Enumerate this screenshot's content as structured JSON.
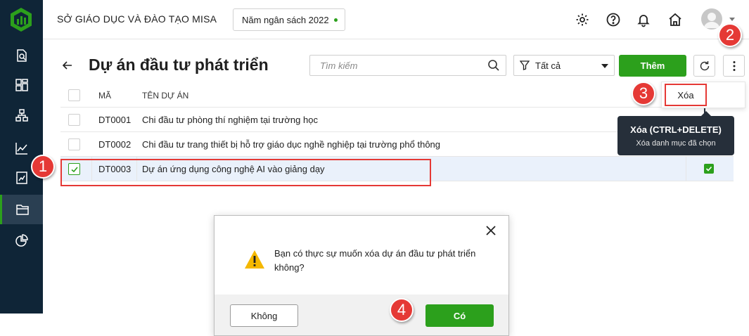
{
  "header": {
    "org_name": "SỞ GIÁO DỤC VÀ ĐÀO TẠO MISA",
    "budget_year": "Năm ngân sách 2022"
  },
  "sidebar": {
    "items": [
      {
        "icon": "search-document-icon"
      },
      {
        "icon": "dashboard-icon"
      },
      {
        "icon": "org-chart-icon"
      },
      {
        "icon": "line-chart-icon"
      },
      {
        "icon": "report-icon"
      },
      {
        "icon": "folder-icon",
        "active": true
      },
      {
        "icon": "pie-chart-icon"
      }
    ]
  },
  "page": {
    "title": "Dự án đầu tư phát triển",
    "search_placeholder": "Tìm kiếm",
    "filter_value": "Tất cả",
    "add_label": "Thêm"
  },
  "table": {
    "columns": [
      "MÃ",
      "TÊN DỰ ÁN"
    ],
    "rows": [
      {
        "code": "DT0001",
        "name": "Chi đầu tư phòng thí nghiệm tại trường học",
        "checked": false
      },
      {
        "code": "DT0002",
        "name": "Chi đầu tư trang thiết bị hỗ trợ giáo dục nghề nghiệp tại trường phổ thông",
        "checked": false
      },
      {
        "code": "DT0003",
        "name": "Dự án ứng dụng công nghệ AI vào giảng dạy",
        "checked": true
      }
    ]
  },
  "menu": {
    "delete_label": "Xóa",
    "tooltip_title": "Xóa (CTRL+DELETE)",
    "tooltip_desc": "Xóa danh mục đã chọn"
  },
  "dialog": {
    "message": "Bạn có thực sự muốn xóa dự án đầu tư phát triển không?",
    "no_label": "Không",
    "yes_label": "Có"
  },
  "callouts": [
    "1",
    "2",
    "3",
    "4"
  ],
  "colors": {
    "sidebar": "#0f2537",
    "accent_green": "#2ca01c",
    "callout_red": "#e53935",
    "tooltip_bg": "#262f3a"
  }
}
